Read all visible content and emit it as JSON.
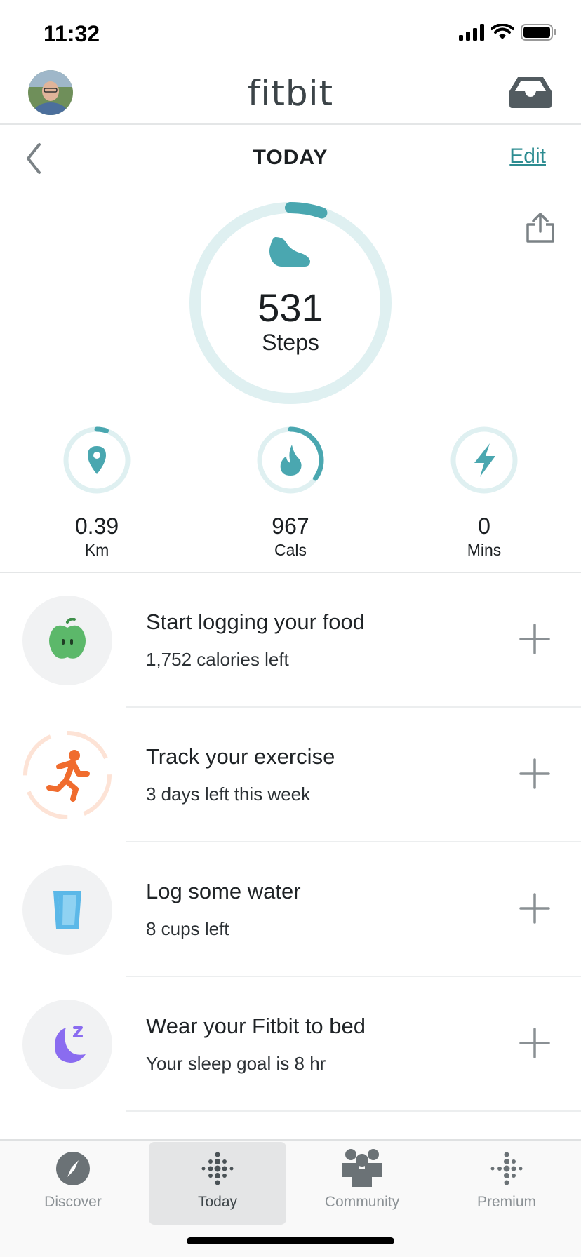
{
  "status_bar": {
    "time": "11:32"
  },
  "header": {
    "app_name": "fitbit"
  },
  "date_nav": {
    "title": "TODAY",
    "edit_label": "Edit"
  },
  "steps": {
    "value": "531",
    "label": "Steps",
    "goal_progress": 0.053
  },
  "stats": [
    {
      "value": "0.39",
      "unit": "Km",
      "icon": "location-pin-icon",
      "progress": 0.05
    },
    {
      "value": "967",
      "unit": "Cals",
      "icon": "flame-icon",
      "progress": 0.35
    },
    {
      "value": "0",
      "unit": "Mins",
      "icon": "lightning-bolt-icon",
      "progress": 0
    }
  ],
  "trackers": [
    {
      "title": "Start logging your food",
      "subtitle": "1,752 calories left",
      "icon": "apple-icon"
    },
    {
      "title": "Track your exercise",
      "subtitle": "3 days left this week",
      "icon": "running-person-icon"
    },
    {
      "title": "Log some water",
      "subtitle": "8 cups left",
      "icon": "water-glass-icon"
    },
    {
      "title": "Wear your Fitbit to bed",
      "subtitle": "Your sleep goal is 8 hr",
      "icon": "moon-icon"
    }
  ],
  "tabbar": [
    {
      "label": "Discover",
      "icon": "compass-icon",
      "active": false
    },
    {
      "label": "Today",
      "icon": "fitbit-dots-icon",
      "active": true
    },
    {
      "label": "Community",
      "icon": "people-icon",
      "active": false
    },
    {
      "label": "Premium",
      "icon": "fitbit-premium-icon",
      "active": false
    }
  ],
  "colors": {
    "accent": "#4aa7b0",
    "ring_track": "#dff0f1",
    "exercise": "#f06c2e",
    "food": "#5cb86a",
    "water": "#5bb8e8",
    "sleep": "#8a6cf0"
  }
}
